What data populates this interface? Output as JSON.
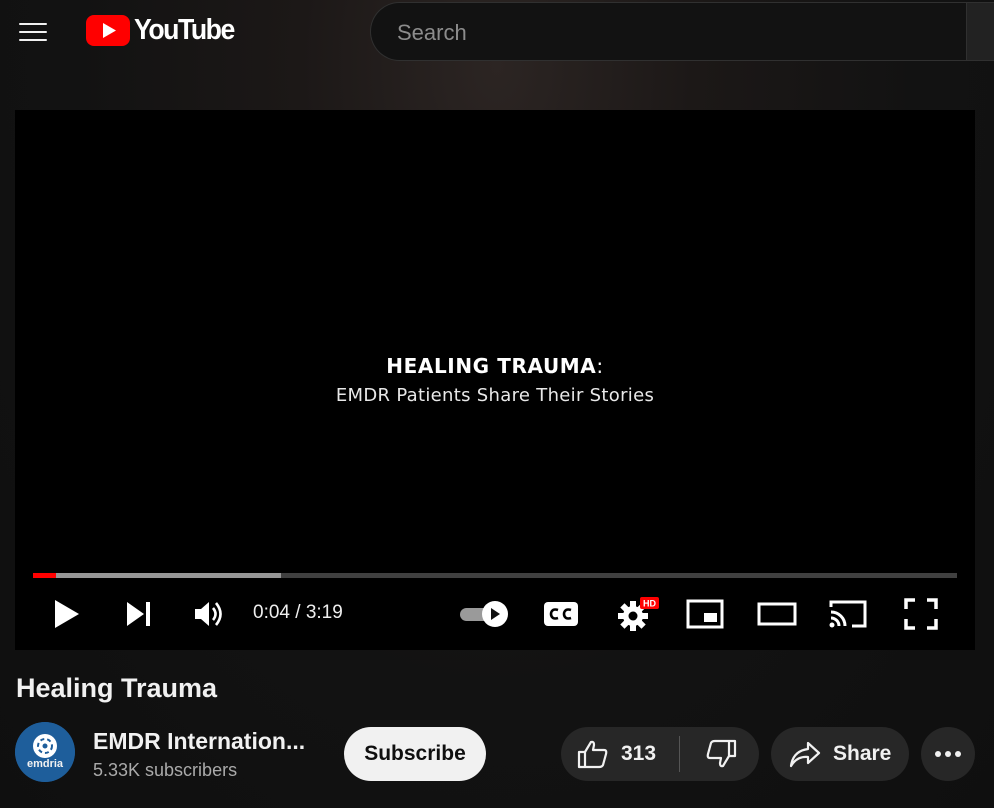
{
  "masthead": {
    "logo_text": "YouTube",
    "search_placeholder": "Search"
  },
  "player": {
    "overlay_title": "HEALING TRAUMA",
    "overlay_colon": ":",
    "overlay_subtitle": "EMDR Patients Share Their Stories",
    "current_time": "0:04",
    "duration": "3:19",
    "time_display": "0:04 / 3:19",
    "progress_played_fraction": 0.025,
    "progress_buffered_fraction": 0.268,
    "autoplay_on": true,
    "quality_badge": "HD",
    "accent_color": "#ff0000"
  },
  "video": {
    "title": "Healing Trauma"
  },
  "channel": {
    "name": "EMDR Internation...",
    "subscribers": "5.33K subscribers",
    "avatar_text": "emdria",
    "subscribe_label": "Subscribe"
  },
  "actions": {
    "like_count": "313",
    "share_label": "Share"
  },
  "icons": {
    "menu": "hamburger-icon",
    "play": "play-icon",
    "next": "next-icon",
    "volume": "volume-icon",
    "autoplay": "autoplay-toggle-icon",
    "captions": "cc-icon",
    "settings": "gear-icon",
    "miniplayer": "miniplayer-icon",
    "theater": "theater-icon",
    "cast": "cast-icon",
    "fullscreen": "fullscreen-icon",
    "like": "thumbs-up-icon",
    "dislike": "thumbs-down-icon",
    "share": "share-arrow-icon",
    "more": "more-horizontal-icon"
  }
}
